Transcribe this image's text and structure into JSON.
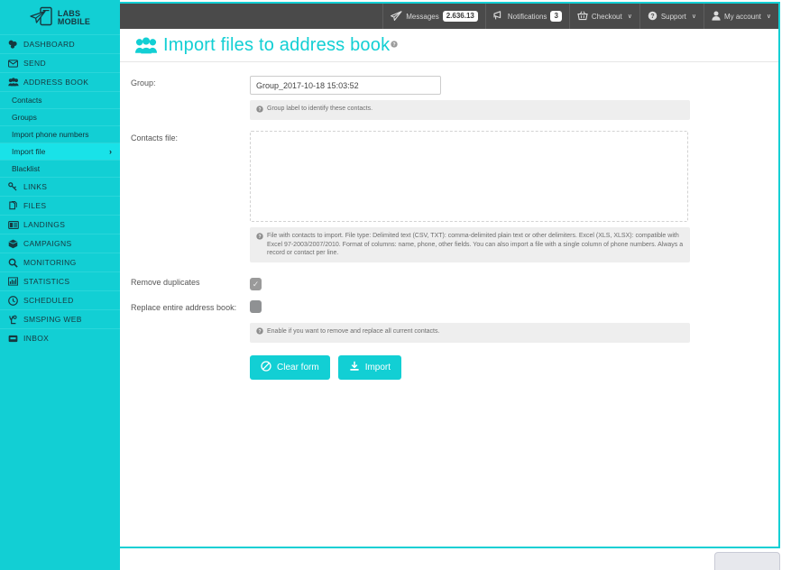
{
  "brand": {
    "logo_line1": "LABS",
    "logo_line2": "MOBILE",
    "accent_color": "#12cfd4",
    "sidebar_active_color": "#19e2e8",
    "topbar_color": "#4a4a4a"
  },
  "sidebar": {
    "items": [
      {
        "label": "DASHBOARD",
        "icon": "dashboard-icon",
        "type": "main"
      },
      {
        "label": "SEND",
        "icon": "envelope-icon",
        "type": "main"
      },
      {
        "label": "ADDRESS BOOK",
        "icon": "people-icon",
        "type": "main"
      },
      {
        "label": "Contacts",
        "icon": "",
        "type": "sub"
      },
      {
        "label": "Groups",
        "icon": "",
        "type": "sub"
      },
      {
        "label": "Import phone numbers",
        "icon": "",
        "type": "sub"
      },
      {
        "label": "Import file",
        "icon": "",
        "type": "sub",
        "active": true,
        "chevron": "›"
      },
      {
        "label": "Blacklist",
        "icon": "",
        "type": "sub"
      },
      {
        "label": "LINKS",
        "icon": "link-icon",
        "type": "main"
      },
      {
        "label": "FILES",
        "icon": "files-icon",
        "type": "main"
      },
      {
        "label": "LANDINGS",
        "icon": "landing-icon",
        "type": "main"
      },
      {
        "label": "CAMPAIGNS",
        "icon": "box-icon",
        "type": "main"
      },
      {
        "label": "MONITORING",
        "icon": "search-icon",
        "type": "main"
      },
      {
        "label": "STATISTICS",
        "icon": "bar-chart-icon",
        "type": "main"
      },
      {
        "label": "SCHEDULED",
        "icon": "clock-icon",
        "type": "main"
      },
      {
        "label": "SMSPING WEB",
        "icon": "smsping-icon",
        "type": "main"
      },
      {
        "label": "INBOX",
        "icon": "inbox-icon",
        "type": "main"
      }
    ]
  },
  "topbar": {
    "messages": {
      "label": "Messages",
      "badge": "2.636.13",
      "icon": "paper-plane-icon"
    },
    "notifications": {
      "label": "Notifications",
      "badge": "3",
      "icon": "megaphone-icon"
    },
    "checkout": {
      "label": "Checkout",
      "caret": "∨",
      "icon": "basket-icon"
    },
    "support": {
      "label": "Support",
      "caret": "∨",
      "icon": "question-circle-icon"
    },
    "account": {
      "label": "My account",
      "caret": "∨",
      "icon": "user-icon"
    }
  },
  "page": {
    "title": "Import files to address book",
    "title_help": "?",
    "title_icon": "people-icon"
  },
  "form": {
    "group": {
      "label": "Group:",
      "value": "Group_2017-10-18 15:03:52",
      "placeholder": "",
      "help": "Group label to identify these contacts."
    },
    "contacts_file": {
      "label": "Contacts file:",
      "help": "File with contacts to import. File type: Delimited text (CSV, TXT): comma-delimited plain text or other delimiters. Excel (XLS, XLSX): compatible with Excel 97-2003/2007/2010. Format of columns: name, phone, other fields. You can also import a file with a single column of phone numbers. Always a record or contact per line."
    },
    "remove_duplicates": {
      "label": "Remove duplicates",
      "checked": true,
      "check_glyph": "✓"
    },
    "replace_address_book": {
      "label": "Replace entire address book:",
      "checked": false,
      "help": "Enable if you want to remove and replace all current contacts."
    },
    "buttons": {
      "clear": {
        "label": "Clear form",
        "icon": "ban-icon"
      },
      "import": {
        "label": "Import",
        "icon": "download-icon"
      }
    }
  }
}
